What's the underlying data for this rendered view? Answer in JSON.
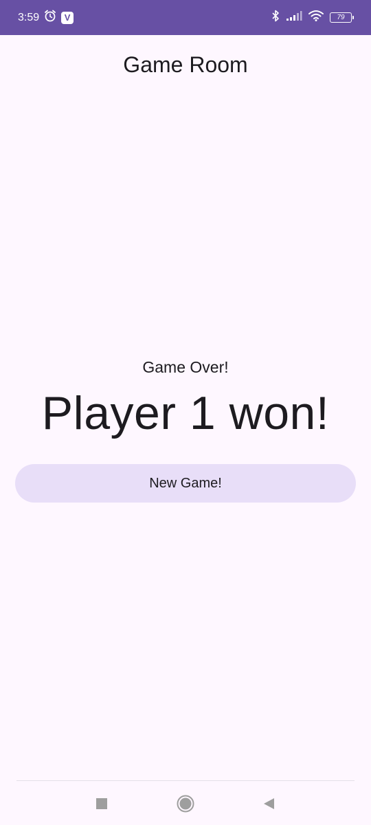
{
  "status_bar": {
    "time": "3:59",
    "battery": "79",
    "icons": [
      "alarm-icon",
      "v-app-icon",
      "bluetooth-icon",
      "signal-icon",
      "wifi-icon",
      "battery-icon"
    ]
  },
  "header": {
    "title": "Game Room"
  },
  "main": {
    "game_over": "Game Over!",
    "winner": "Player 1 won!",
    "new_game_label": "New Game!"
  },
  "nav_bar": {
    "icons": [
      "recents-icon",
      "home-icon",
      "back-icon"
    ]
  },
  "colors": {
    "status_bar": "#6750a4",
    "background": "#fef7ff",
    "button": "#e8def8",
    "text": "#1d1b20"
  }
}
